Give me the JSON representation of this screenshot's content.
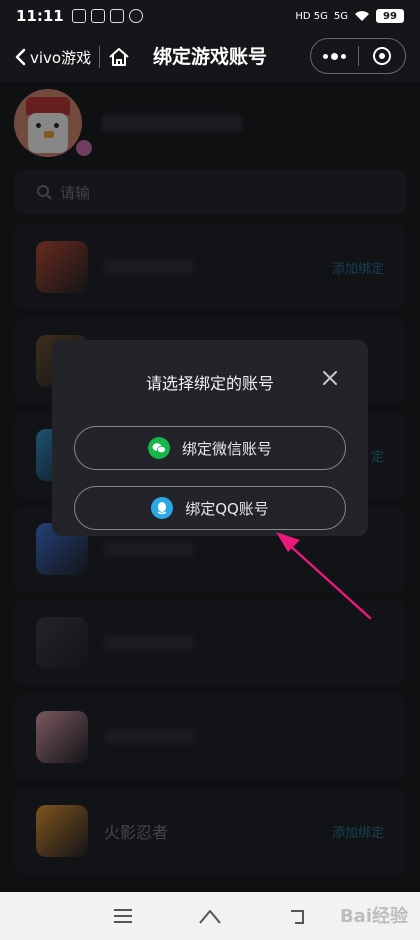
{
  "status_bar": {
    "time": "11:11",
    "network_1": "HD 5G",
    "network_2": "5G",
    "battery": "99"
  },
  "nav_bar": {
    "back_label": "vivo游戏",
    "title": "绑定游戏账号"
  },
  "search": {
    "placeholder": "请输"
  },
  "games": [
    {
      "name": "",
      "bind_label": "添加绑定",
      "icon_color": "#b5482c"
    },
    {
      "name": "",
      "bind_label": "",
      "icon_color": "#6a4e2e"
    },
    {
      "name": "",
      "bind_label": "定",
      "icon_color": "#2c8fc7"
    },
    {
      "name": "",
      "bind_label": "",
      "icon_color": "#3c6fd1"
    },
    {
      "name": "",
      "bind_label": "",
      "icon_color": "#3a3c40"
    },
    {
      "name": "",
      "bind_label": "",
      "icon_color": "#d99aa5"
    },
    {
      "name": "火影忍者",
      "bind_label": "添加绑定",
      "icon_color": "#e3922f"
    }
  ],
  "modal": {
    "title": "请选择绑定的账号",
    "wechat_label": "绑定微信账号",
    "qq_label": "绑定QQ账号"
  },
  "colors": {
    "wechat": "#17b64b",
    "qq": "#2aa7e6",
    "arrow": "#e8197a",
    "bind_link": "#1f6f8c"
  },
  "watermark": "Bai经验"
}
